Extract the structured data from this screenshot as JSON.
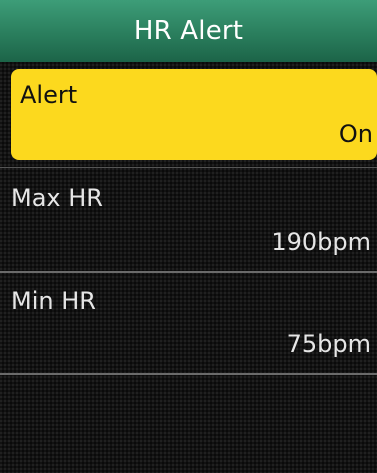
{
  "header": {
    "title": "HR Alert"
  },
  "items": [
    {
      "label": "Alert",
      "value": "On"
    },
    {
      "label": "Max HR",
      "value": "190bpm"
    },
    {
      "label": "Min HR",
      "value": "75bpm"
    }
  ],
  "colors": {
    "header_green": "#2a7e5d",
    "selected_yellow": "#fcd91e",
    "background": "#121212"
  }
}
